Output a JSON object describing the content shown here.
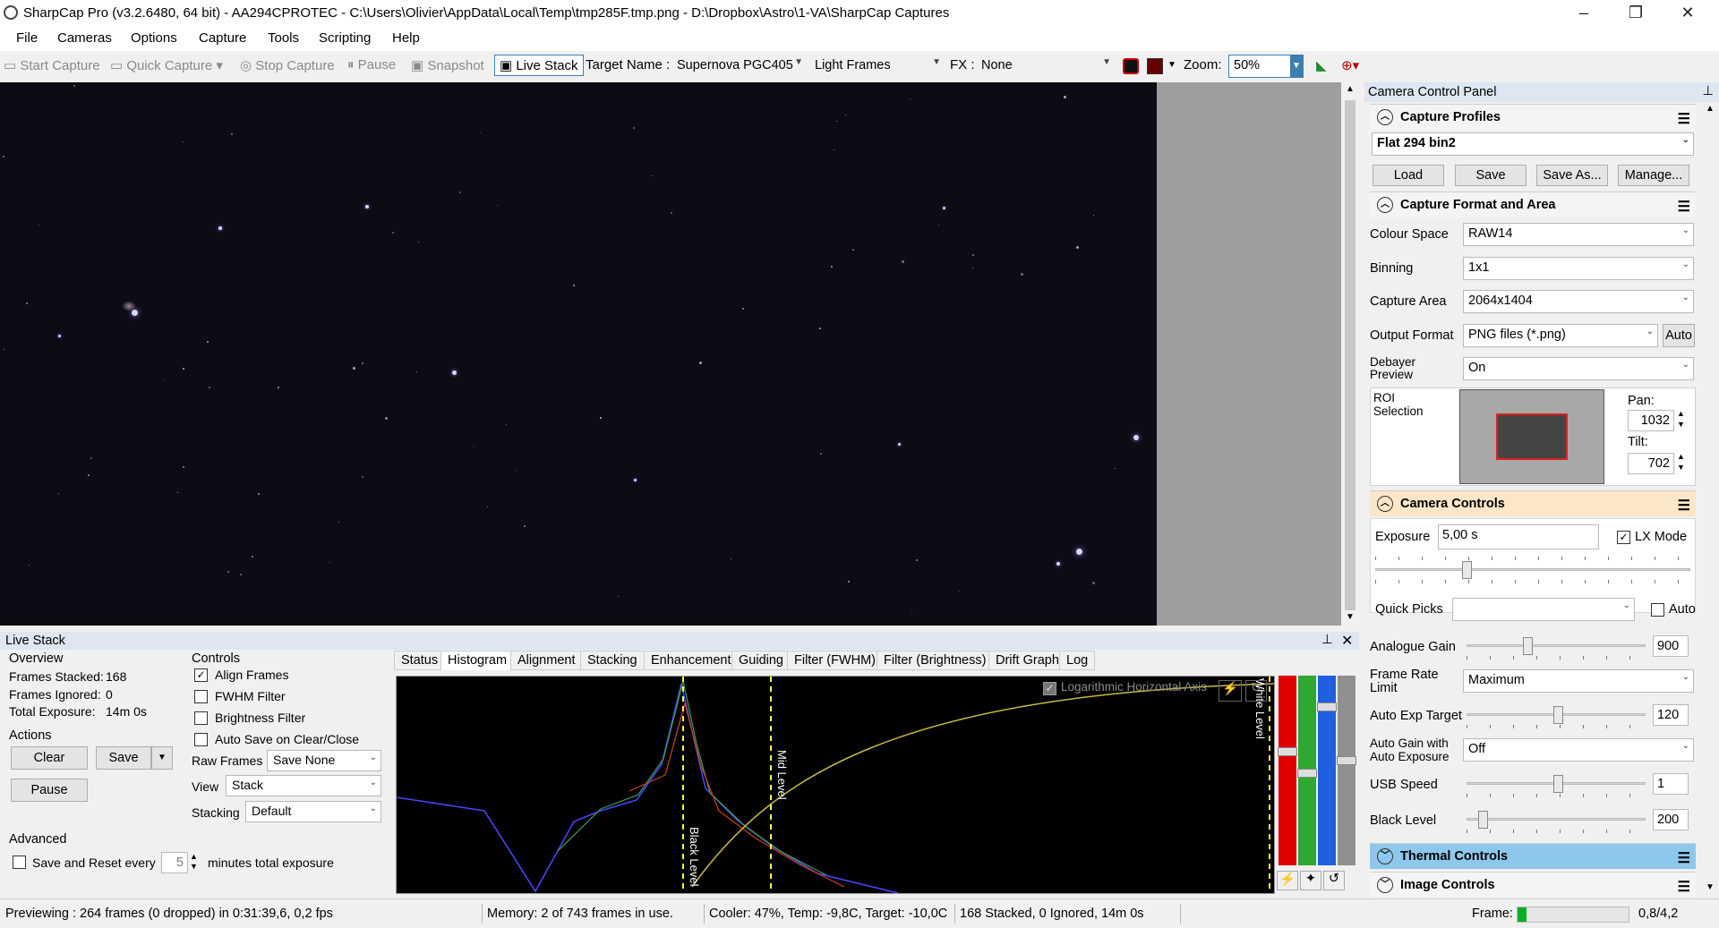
{
  "title": "SharpCap Pro (v3.2.6480, 64 bit) - AA294CPROTEC - C:\\Users\\Olivier\\AppData\\Local\\Temp\\tmp285F.tmp.png - D:\\Dropbox\\Astro\\1-VA\\SharpCap Captures",
  "menu": [
    "File",
    "Cameras",
    "Options",
    "Capture",
    "Tools",
    "Scripting",
    "Help"
  ],
  "toolbar": {
    "start_capture": "Start Capture",
    "quick_capture": "Quick Capture",
    "stop_capture": "Stop Capture",
    "pause": "Pause",
    "snapshot": "Snapshot",
    "live_stack": "Live Stack",
    "target_label": "Target Name :",
    "target_value": "Supernova PGC405",
    "frames_type": "Light Frames",
    "fx_label": "FX :",
    "fx_value": "None",
    "zoom_label": "Zoom:",
    "zoom_value": "50%"
  },
  "panel": {
    "title": "Camera Control Panel",
    "profiles": {
      "header": "Capture Profiles",
      "selected": "Flat 294 bin2",
      "load": "Load",
      "save": "Save",
      "save_as": "Save As...",
      "manage": "Manage..."
    },
    "format": {
      "header": "Capture Format and Area",
      "colour_space_label": "Colour Space",
      "colour_space": "RAW14",
      "binning_label": "Binning",
      "binning": "1x1",
      "capture_area_label": "Capture Area",
      "capture_area": "2064x1404",
      "output_format_label": "Output Format",
      "output_format": "PNG files (*.png)",
      "auto": "Auto",
      "debayer_label1": "Debayer",
      "debayer_label2": "Preview",
      "debayer": "On",
      "roi_label1": "ROI",
      "roi_label2": "Selection",
      "pan_label": "Pan:",
      "pan": "1032",
      "tilt_label": "Tilt:",
      "tilt": "702"
    },
    "camera": {
      "header": "Camera Controls",
      "exposure_label": "Exposure",
      "exposure": "5,00 s",
      "lx_mode": "LX Mode",
      "quick_picks": "Quick Picks",
      "auto": "Auto",
      "gain_label": "Analogue Gain",
      "gain": "900",
      "frame_rate_label1": "Frame Rate",
      "frame_rate_label2": "Limit",
      "frame_rate": "Maximum",
      "auto_exp_label": "Auto Exp Target",
      "auto_exp": "120",
      "auto_gain_label1": "Auto Gain with",
      "auto_gain_label2": "Auto Exposure",
      "auto_gain": "Off",
      "usb_label": "USB Speed",
      "usb": "1",
      "black_label": "Black Level",
      "black": "200"
    },
    "thermal": "Thermal Controls",
    "image": "Image Controls"
  },
  "livestack": {
    "title": "Live Stack",
    "overview": "Overview",
    "frames_stacked_label": "Frames Stacked:",
    "frames_stacked": "168",
    "frames_ignored_label": "Frames Ignored:",
    "frames_ignored": "0",
    "total_exposure_label": "Total Exposure:",
    "total_exposure": "14m 0s",
    "actions": "Actions",
    "clear": "Clear",
    "save": "Save",
    "pause": "Pause",
    "advanced": "Advanced",
    "save_reset": "Save and Reset every",
    "minutes_value": "5",
    "minutes_label": "minutes total exposure",
    "controls": "Controls",
    "align": "Align Frames",
    "fwhm": "FWHM Filter",
    "brightness": "Brightness Filter",
    "autosave": "Auto Save on Clear/Close",
    "raw_frames_label": "Raw Frames",
    "raw_frames": "Save None",
    "view_label": "View",
    "view": "Stack",
    "stacking_label": "Stacking",
    "stacking": "Default",
    "tabs": [
      "Status",
      "Histogram",
      "Alignment",
      "Stacking",
      "Enhancement",
      "Guiding",
      "Filter (FWHM)",
      "Filter (Brightness)",
      "Drift Graph",
      "Log"
    ],
    "log_axis": "Logarithmic Horizontal Axis",
    "black_level": "Black Level",
    "mid_level": "Mid Level",
    "white_level": "White Level"
  },
  "status": {
    "preview": "Previewing : 264 frames (0 dropped) in 0:31:39,6, 0,2 fps",
    "memory": "Memory: 2 of 743 frames in use.",
    "cooler": "Cooler: 47%, Temp: -9,8C, Target: -10,0C",
    "stacked": "168 Stacked, 0 Ignored, 14m 0s",
    "frame_label": "Frame:",
    "frame_value": "0,8/4,2",
    "frame_progress": 0.08
  }
}
